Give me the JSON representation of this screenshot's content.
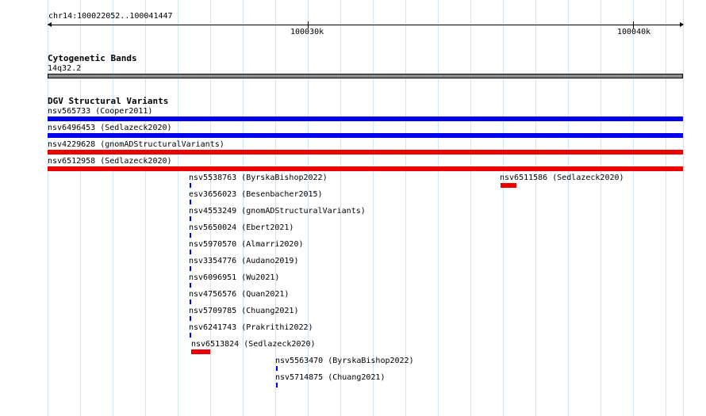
{
  "ruler": {
    "location": "chr14:100022052..100041447",
    "ticks": [
      "100030k",
      "100040k"
    ]
  },
  "cytogenetic": {
    "title": "Cytogenetic Bands",
    "band": "14q32.2",
    "color": "#8c8c8c"
  },
  "dgv": {
    "title": "DGV Structural Variants",
    "colors": {
      "gain": "#0000ee",
      "loss": "#ee0000"
    },
    "features": [
      {
        "label": "nsv565733 (Cooper2011)",
        "type": "gain"
      },
      {
        "label": "nsv6496453 (Sedlazeck2020)",
        "type": "gain"
      },
      {
        "label": "nsv4229628 (gnomADStructuralVariants)",
        "type": "loss"
      },
      {
        "label": "nsv6512958 (Sedlazeck2020)",
        "type": "loss"
      },
      {
        "label": "nsv5538763 (ByrskaBishop2022)",
        "type": "gain"
      },
      {
        "label": "nsv6511586 (Sedlazeck2020)",
        "type": "loss"
      },
      {
        "label": "esv3656023 (Besenbacher2015)",
        "type": "gain"
      },
      {
        "label": "nsv4553249 (gnomADStructuralVariants)",
        "type": "gain"
      },
      {
        "label": "nsv5650024 (Ebert2021)",
        "type": "gain"
      },
      {
        "label": "nsv5970570 (Almarri2020)",
        "type": "gain"
      },
      {
        "label": "nsv3354776 (Audano2019)",
        "type": "gain"
      },
      {
        "label": "nsv6096951 (Wu2021)",
        "type": "gain"
      },
      {
        "label": "nsv4756576 (Quan2021)",
        "type": "gain"
      },
      {
        "label": "nsv5709785 (Chuang2021)",
        "type": "gain"
      },
      {
        "label": "nsv6241743 (Prakrithi2022)",
        "type": "gain"
      },
      {
        "label": "nsv6513824 (Sedlazeck2020)",
        "type": "loss"
      },
      {
        "label": "nsv5563470 (ByrskaBishop2022)",
        "type": "gain"
      },
      {
        "label": "nsv5714875 (Chuang2021)",
        "type": "gain"
      }
    ]
  }
}
